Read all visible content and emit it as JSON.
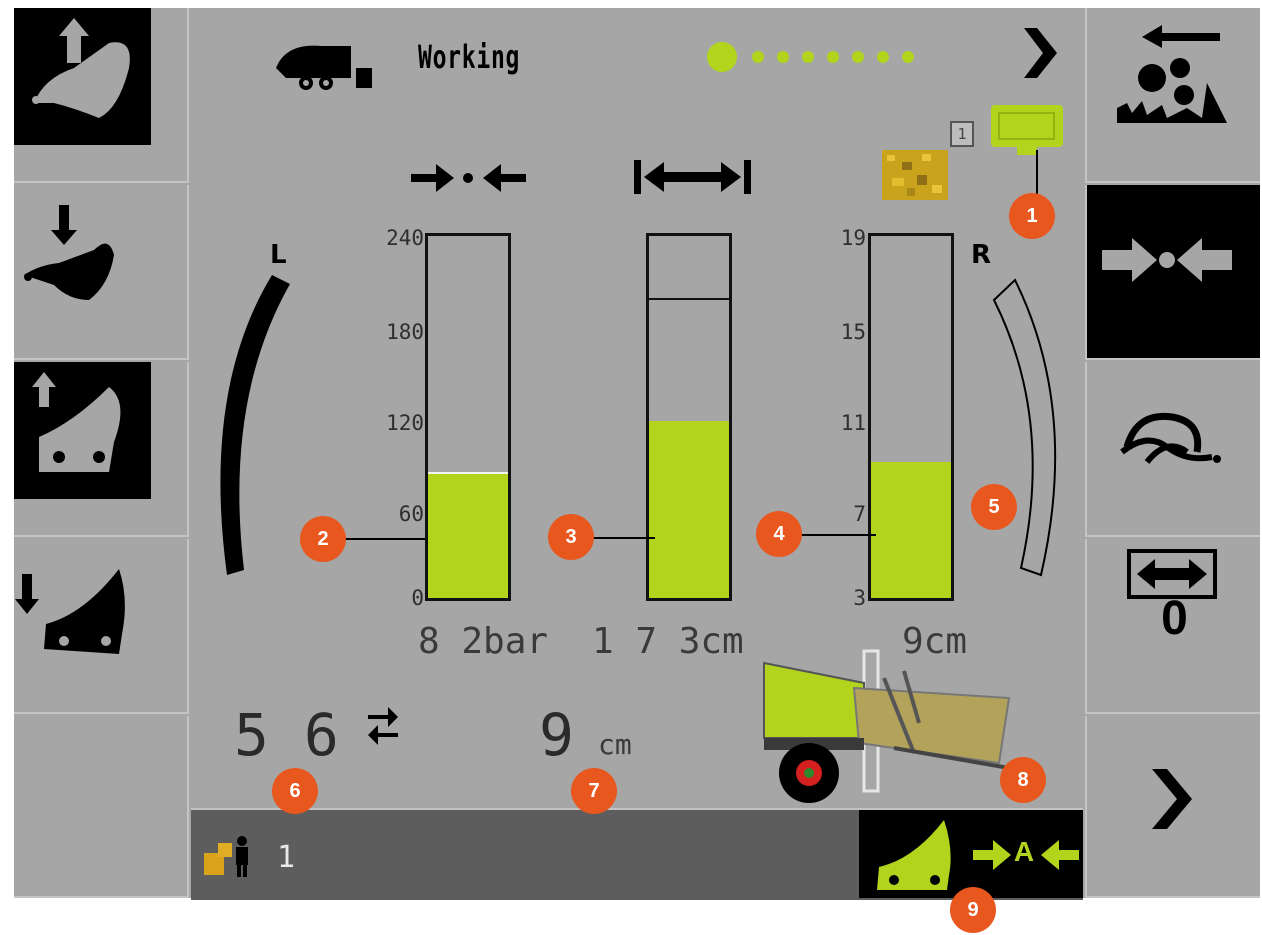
{
  "header": {
    "mode_label": "Working",
    "page_indicator_count": 8,
    "page_indicator_active": 0,
    "next_icon": "chevron-right-icon",
    "terminal_badge": "1"
  },
  "left_buttons": [
    {
      "name": "pickup-raise-button",
      "icon": "pickup-up-icon"
    },
    {
      "name": "pickup-lower-button",
      "icon": "pickup-down-icon"
    },
    {
      "name": "tailgate-open-button",
      "icon": "tailgate-up-icon"
    },
    {
      "name": "tailgate-close-button",
      "icon": "tailgate-down-icon"
    },
    {
      "name": "empty-left-button",
      "icon": ""
    }
  ],
  "right_buttons": [
    {
      "name": "feed-rotor-button",
      "icon": "rotor-reverse-icon"
    },
    {
      "name": "pressure-button",
      "icon": "compress-icon"
    },
    {
      "name": "net-wrap-button",
      "icon": "net-wrap-icon"
    },
    {
      "name": "width-reset-button",
      "icon": "width-arrows-icon",
      "label": "0"
    },
    {
      "name": "next-page-button",
      "icon": "chevron-right-icon"
    }
  ],
  "gauges": {
    "pressure": {
      "icon": "compress-arrows-icon",
      "scale": [
        "240",
        "180",
        "120",
        "60",
        "0"
      ],
      "value": 82,
      "max": 240,
      "readout": "8 2bar"
    },
    "diameter": {
      "icon": "width-arrows-icon",
      "value": 173,
      "fraction": 0.49,
      "marker_fraction": 0.83,
      "readout": "1 7 3cm"
    },
    "layer": {
      "icon": "crop-texture-icon",
      "scale": [
        "19",
        "15",
        "11",
        "7",
        "3"
      ],
      "value": 9,
      "min": 3,
      "max": 19,
      "readout": "9cm"
    }
  },
  "side_indicators": {
    "left_label": "L",
    "right_label": "R"
  },
  "bottom_values": {
    "bale_count": "5 6",
    "bale_count_icon": "swap-arrows-icon",
    "layer_value": "9",
    "layer_unit": "cm"
  },
  "status_bar": {
    "bale_counter_icon": "bale-operator-icon",
    "counter_value": "1",
    "tailgate_icon": "tailgate-icon",
    "auto_icon": "auto-compress-icon",
    "auto_label": "A"
  },
  "callouts": [
    "1",
    "2",
    "3",
    "4",
    "5",
    "6",
    "7",
    "8",
    "9"
  ],
  "colors": {
    "accent_green": "#b2d41d",
    "callout_orange": "#e8571e",
    "screen_gray": "#a6a6a6"
  }
}
